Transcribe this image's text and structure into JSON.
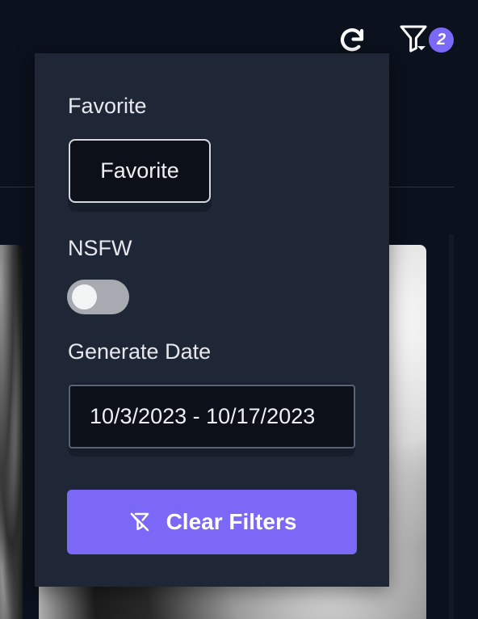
{
  "header": {
    "refresh_icon": "refresh-icon",
    "filter_icon": "filter-icon",
    "filter_badge": "2"
  },
  "filters": {
    "favorite": {
      "label": "Favorite",
      "chip_label": "Favorite"
    },
    "nsfw": {
      "label": "NSFW",
      "enabled": false
    },
    "generate_date": {
      "label": "Generate Date",
      "value": "10/3/2023 - 10/17/2023"
    },
    "clear_button": {
      "label": "Clear Filters",
      "icon": "filter-off-icon"
    }
  },
  "colors": {
    "accent": "#7b68f6",
    "popover_bg": "#1f2737",
    "page_bg": "#0b111d"
  }
}
